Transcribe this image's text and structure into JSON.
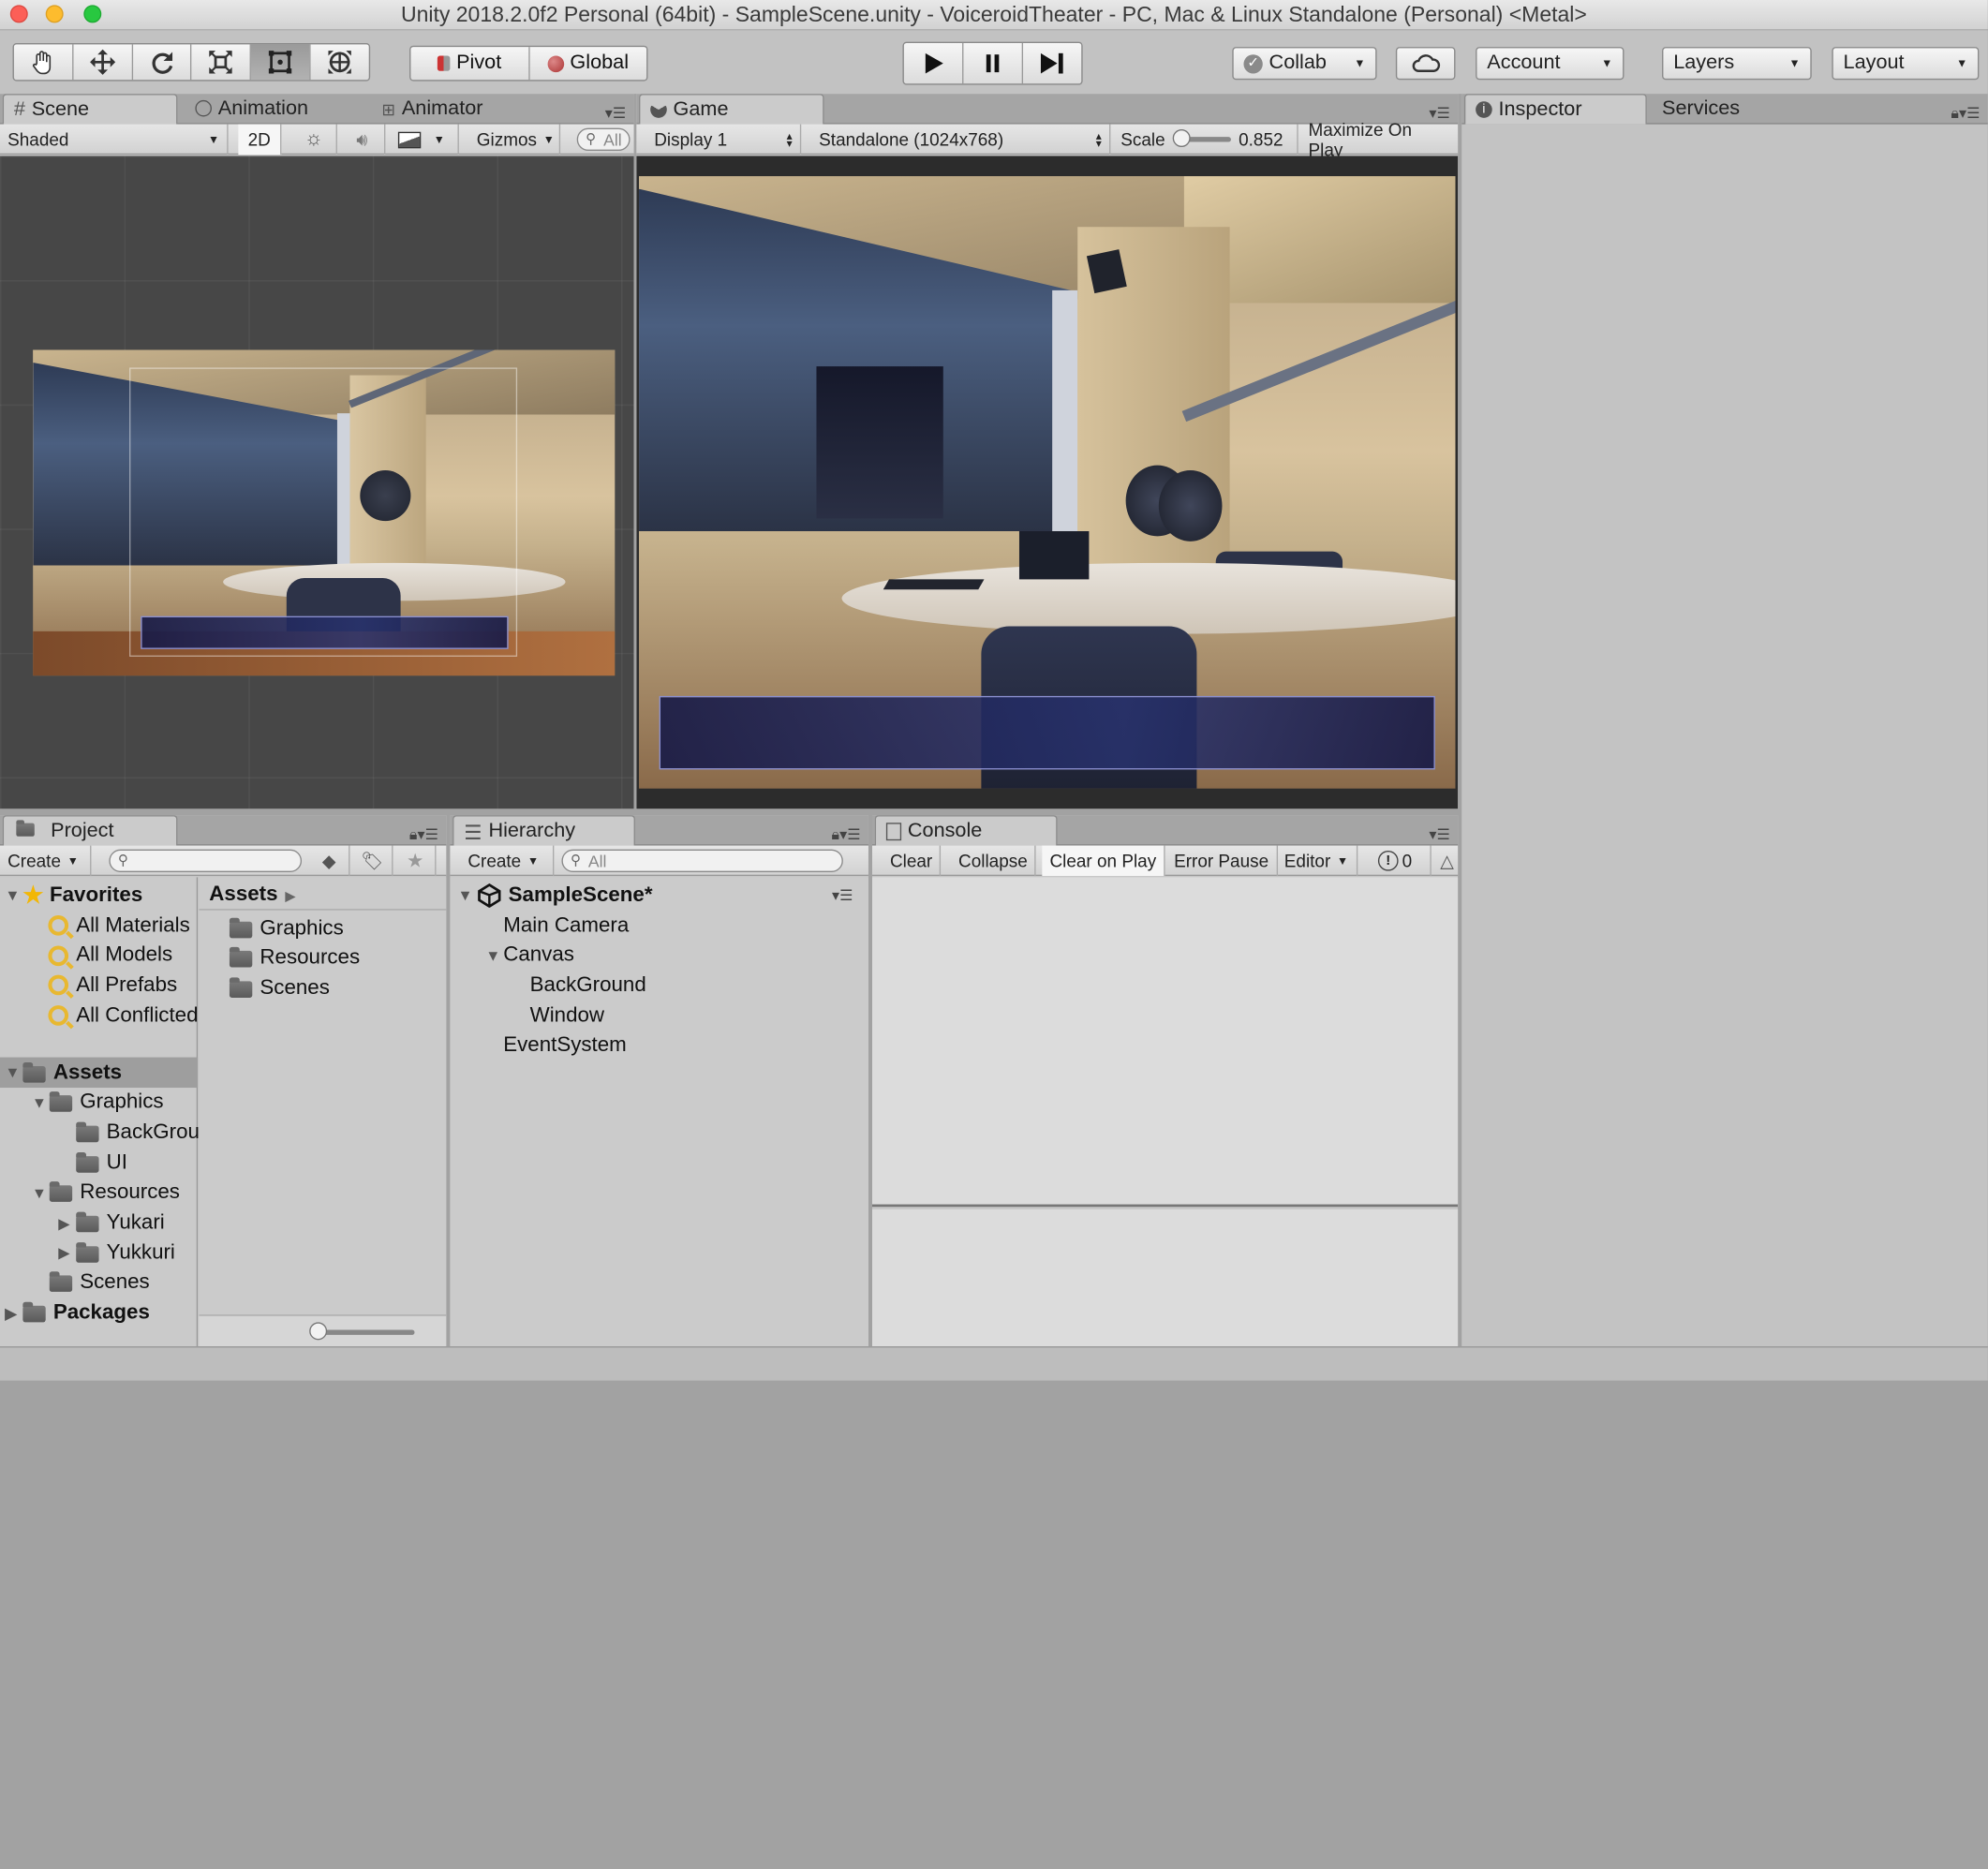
{
  "window_title": "Unity 2018.2.0f2 Personal (64bit) - SampleScene.unity - VoiceroidTheater - PC, Mac & Linux Standalone (Personal) <Metal>",
  "toolbar": {
    "tools": [
      "hand-tool",
      "move-tool",
      "rotate-tool",
      "scale-tool",
      "rect-tool",
      "transform-tool"
    ],
    "pivot": "Pivot",
    "global": "Global",
    "collab": "Collab",
    "account": "Account",
    "layers": "Layers",
    "layout": "Layout"
  },
  "scene_panel": {
    "tabs": [
      "Scene",
      "Animation",
      "Animator"
    ],
    "shading": "Shaded",
    "mode_2d": "2D",
    "gizmos": "Gizmos",
    "search_placeholder": "All"
  },
  "game_panel": {
    "tab": "Game",
    "display": "Display 1",
    "resolution": "Standalone (1024x768)",
    "scale_label": "Scale",
    "scale_value": "0.852",
    "maximize": "Maximize On Play"
  },
  "inspector_panel": {
    "tabs": [
      "Inspector",
      "Services"
    ]
  },
  "project_panel": {
    "tab": "Project",
    "create": "Create",
    "favorites": {
      "label": "Favorites",
      "items": [
        "All Materials",
        "All Models",
        "All Prefabs",
        "All Conflicted"
      ]
    },
    "tree": [
      {
        "label": "Assets",
        "depth": 0,
        "fold": "open"
      },
      {
        "label": "Graphics",
        "depth": 1,
        "fold": "open"
      },
      {
        "label": "BackGround",
        "depth": 2,
        "fold": "none"
      },
      {
        "label": "UI",
        "depth": 2,
        "fold": "none"
      },
      {
        "label": "Resources",
        "depth": 1,
        "fold": "open"
      },
      {
        "label": "Yukari",
        "depth": 2,
        "fold": "closed"
      },
      {
        "label": "Yukkuri",
        "depth": 2,
        "fold": "closed"
      },
      {
        "label": "Scenes",
        "depth": 1,
        "fold": "none"
      },
      {
        "label": "Packages",
        "depth": 0,
        "fold": "closed"
      }
    ],
    "assets_header": "Assets",
    "assets_items": [
      "Graphics",
      "Resources",
      "Scenes"
    ]
  },
  "hierarchy_panel": {
    "tab": "Hierarchy",
    "create": "Create",
    "search_placeholder": "All",
    "scene": "SampleScene*",
    "items": [
      {
        "label": "Main Camera",
        "depth": 1,
        "fold": "none"
      },
      {
        "label": "Canvas",
        "depth": 1,
        "fold": "open"
      },
      {
        "label": "BackGround",
        "depth": 2,
        "fold": "none"
      },
      {
        "label": "Window",
        "depth": 2,
        "fold": "none"
      },
      {
        "label": "EventSystem",
        "depth": 1,
        "fold": "none"
      }
    ]
  },
  "console_panel": {
    "tab": "Console",
    "buttons": [
      "Clear",
      "Collapse",
      "Clear on Play",
      "Error Pause",
      "Editor"
    ],
    "error_count": "0"
  },
  "colors": {
    "panel": "#c8c8c8",
    "scene_bg": "#474747",
    "msgbox": "#1c1f55"
  }
}
